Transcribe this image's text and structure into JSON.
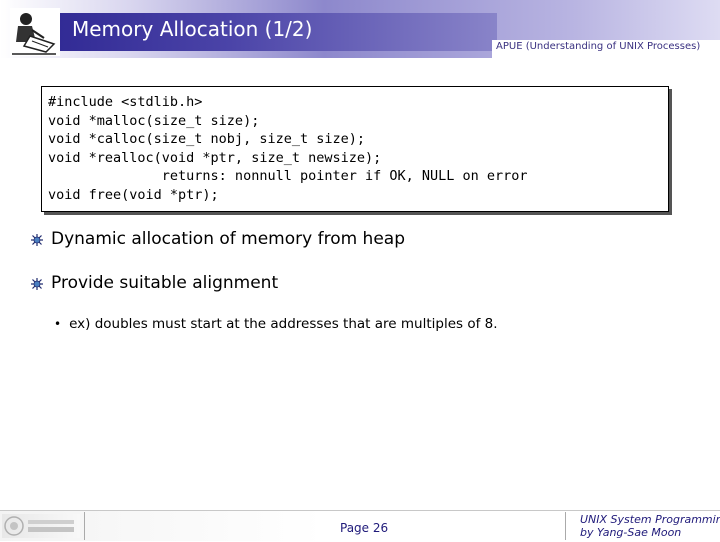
{
  "header": {
    "title": "Memory Allocation (1/2)",
    "subtitle": "APUE (Understanding of UNIX Processes)"
  },
  "code": {
    "lines": [
      "#include <stdlib.h>",
      "void *malloc(size_t size);",
      "void *calloc(size_t nobj, size_t size);",
      "void *realloc(void *ptr, size_t newsize);",
      "              returns: nonnull pointer if OK, NULL on error",
      "void free(void *ptr);"
    ]
  },
  "bullets": [
    {
      "text": "Dynamic allocation of memory from heap"
    },
    {
      "text": "Provide suitable alignment"
    }
  ],
  "sub_bullets": [
    {
      "text": "ex) doubles must start at the addresses that are multiples of 8."
    }
  ],
  "footer": {
    "page": "Page 26",
    "course_line1": "UNIX System Programming",
    "course_line2": "by Yang-Sae Moon"
  },
  "colors": {
    "title_bar": "#2b2490",
    "accent_text": "#1f1a7a"
  }
}
